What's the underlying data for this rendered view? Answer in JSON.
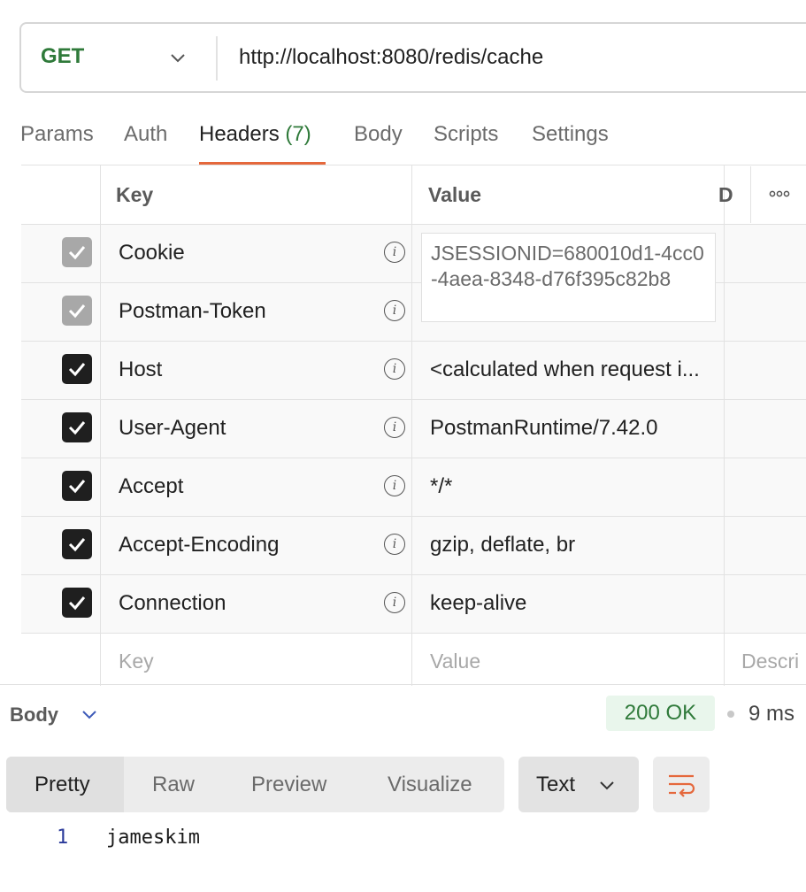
{
  "request": {
    "method": "GET",
    "url": "http://localhost:8080/redis/cache"
  },
  "tabs": [
    {
      "label": "Params"
    },
    {
      "label": "Auth"
    },
    {
      "label": "Headers",
      "count": "(7)"
    },
    {
      "label": "Body"
    },
    {
      "label": "Scripts"
    },
    {
      "label": "Settings"
    }
  ],
  "headers_table": {
    "columns": {
      "key": "Key",
      "value": "Value",
      "description": "D"
    },
    "rows": [
      {
        "key": "Cookie",
        "value": "",
        "checked": true,
        "auto": true
      },
      {
        "key": "Postman-Token",
        "value": "",
        "checked": true,
        "auto": true
      },
      {
        "key": "Host",
        "value": "<calculated when request i...",
        "checked": true,
        "auto": false
      },
      {
        "key": "User-Agent",
        "value": "PostmanRuntime/7.42.0",
        "checked": true,
        "auto": false
      },
      {
        "key": "Accept",
        "value": "*/*",
        "checked": true,
        "auto": false
      },
      {
        "key": "Accept-Encoding",
        "value": "gzip, deflate, br",
        "checked": true,
        "auto": false
      },
      {
        "key": "Connection",
        "value": "keep-alive",
        "checked": true,
        "auto": false
      }
    ],
    "placeholders": {
      "key": "Key",
      "value": "Value",
      "description": "Descri"
    },
    "cookie_popover": "JSESSIONID=680010d1-4cc0-4aea-8348-d76f395c82b8",
    "more_icon": "more-horizontal-icon"
  },
  "response": {
    "body_label": "Body",
    "status": "200 OK",
    "time": "9 ms",
    "view_tabs": [
      {
        "label": "Pretty"
      },
      {
        "label": "Raw"
      },
      {
        "label": "Preview"
      },
      {
        "label": "Visualize"
      }
    ],
    "format": "Text",
    "wrap_icon": "wrap-lines-icon",
    "lines": [
      {
        "number": "1",
        "text": "jameskim"
      }
    ]
  },
  "colors": {
    "method": "#2f7a3a",
    "accent": "#e5683c",
    "status_bg": "#e9f6ec"
  }
}
